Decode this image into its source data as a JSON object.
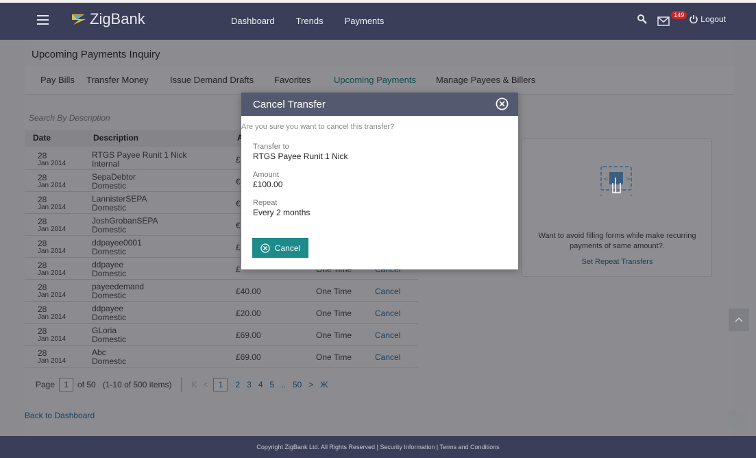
{
  "header": {
    "brand": "ZigBank",
    "nav": [
      "Dashboard",
      "Trends",
      "Payments"
    ],
    "mail_count": "149",
    "logout_label": "Logout"
  },
  "page": {
    "title": "Upcoming Payments Inquiry",
    "tabs": [
      "Pay Bills",
      "Transfer Money",
      "Issue Demand Drafts",
      "Favorites",
      "Upcoming Payments",
      "Manage Payees & Billers"
    ],
    "active_tab": "Upcoming Payments",
    "search_placeholder": "Search By Description"
  },
  "table": {
    "columns": [
      "Date",
      "Description",
      "A"
    ],
    "rows": [
      {
        "day": "28",
        "month_year": "Jan 2014",
        "desc1": "RTGS Payee Runit 1 Nick",
        "desc2": "Internal",
        "amount": "£",
        "freq": "",
        "action": ""
      },
      {
        "day": "28",
        "month_year": "Jan 2014",
        "desc1": "SepaDebtor",
        "desc2": "Domestic",
        "amount": "€",
        "freq": "",
        "action": ""
      },
      {
        "day": "28",
        "month_year": "Jan 2014",
        "desc1": "LannisterSEPA",
        "desc2": "Domestic",
        "amount": "€",
        "freq": "",
        "action": ""
      },
      {
        "day": "28",
        "month_year": "Jan 2014",
        "desc1": "JoshGrobanSEPA",
        "desc2": "Domestic",
        "amount": "€",
        "freq": "",
        "action": ""
      },
      {
        "day": "28",
        "month_year": "Jan 2014",
        "desc1": "ddpayee0001",
        "desc2": "Domestic",
        "amount": "£",
        "freq": "",
        "action": ""
      },
      {
        "day": "28",
        "month_year": "Jan 2014",
        "desc1": "ddpayee",
        "desc2": "Domestic",
        "amount": "£",
        "freq": "One Time",
        "action": "Cancel"
      },
      {
        "day": "28",
        "month_year": "Jan 2014",
        "desc1": "payeedemand",
        "desc2": "Domestic",
        "amount": "£40.00",
        "freq": "One Time",
        "action": "Cancel"
      },
      {
        "day": "28",
        "month_year": "Jan 2014",
        "desc1": "ddpayee",
        "desc2": "Domestic",
        "amount": "£20.00",
        "freq": "One Time",
        "action": "Cancel"
      },
      {
        "day": "28",
        "month_year": "Jan 2014",
        "desc1": "GLoria",
        "desc2": "Domestic",
        "amount": "£69.00",
        "freq": "One Time",
        "action": "Cancel"
      },
      {
        "day": "28",
        "month_year": "Jan 2014",
        "desc1": "Abc",
        "desc2": "Domestic",
        "amount": "£69.00",
        "freq": "One Time",
        "action": "Cancel"
      }
    ]
  },
  "pager": {
    "page_label": "Page",
    "current": "1",
    "of_text": "of 50",
    "items_text": "(1-10 of 500 items)",
    "pages": [
      "1",
      "2",
      "3",
      "4",
      "5",
      "..",
      "50"
    ]
  },
  "side_card": {
    "text": "Want to avoid filling forms while make recurring payments of same amount?.",
    "link": "Set Repeat Transfers"
  },
  "back_link": "Back to Dashboard",
  "footer": "Copyright ZigBank Ltd. All Rights Reserved | Security Information | Terms and Conditions",
  "modal": {
    "title": "Cancel Transfer",
    "question": "Are you sure you want to cancel this transfer?",
    "transfer_to_label": "Transfer to",
    "transfer_to_value": "RTGS Payee Runit 1 Nick",
    "amount_label": "Amount",
    "amount_value": "£100.00",
    "repeat_label": "Repeat",
    "repeat_value": "Every 2 months",
    "cancel_button": "Cancel"
  },
  "colors": {
    "header_bg": "#3b3e59",
    "modal_header": "#53596f",
    "primary_button": "#1e8a8a",
    "active_tab": "#0f4b4b",
    "badge": "#c62828"
  }
}
